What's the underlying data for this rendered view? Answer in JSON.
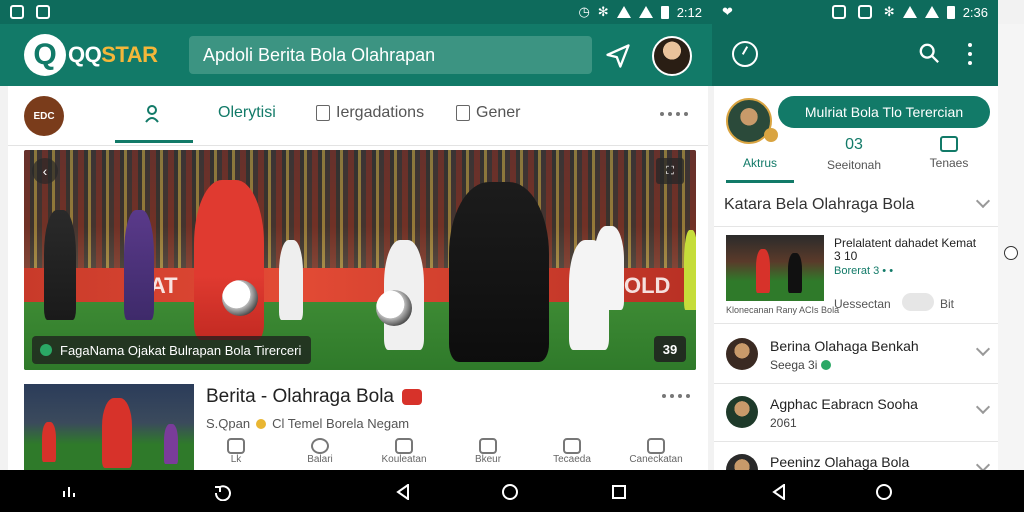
{
  "status_left": {
    "time": "2:12"
  },
  "status_right": {
    "time": "2:36"
  },
  "app": {
    "logo_q": "Q",
    "logo_text_a": "QQ",
    "logo_text_b": "STAR",
    "search_placeholder": "Apdoli Berita Bola Olahrapan"
  },
  "tabs": {
    "channel_logo": "EDC",
    "items": [
      {
        "label": "Olerytisi"
      },
      {
        "label": "Iergadations"
      },
      {
        "label": "Gener"
      }
    ]
  },
  "hero": {
    "ad_1": "DAT",
    "ad_2": "OLD",
    "expand_label": "⛶",
    "caption": "FagaNama Ojakat Bulrapan Bola Tirerceri",
    "count": "39"
  },
  "article": {
    "title": "Berita - Olahraga Bola",
    "meta_source": "S.Qpan",
    "meta_text": "Cl Temel Borela Negam",
    "actions": [
      {
        "label": "Lk"
      },
      {
        "label": "Balari"
      },
      {
        "label": "Kouleatan"
      },
      {
        "label": "Bkeur"
      },
      {
        "label": "Tecaeda"
      },
      {
        "label": "Caneckatan"
      }
    ]
  },
  "right": {
    "cta": "Mulriat Bola Tlo Terercian",
    "tabs": [
      {
        "label": "Aktrus",
        "count": ""
      },
      {
        "label": "Seeitonah",
        "count": "03"
      },
      {
        "label": "Tenaes",
        "count": ""
      }
    ],
    "section_title": "Katara Bela Olahraga Bola",
    "card": {
      "title": "Prelalatent dahadet Kemat 3 10",
      "sub": "Borerat 3 • •",
      "source": "Klonecanan Rany ACIs Bola",
      "foot": "Uessectan",
      "foot2": "Bit"
    },
    "items": [
      {
        "name": "Berina Olahaga Benkah",
        "sub": "Seega 3i"
      },
      {
        "name": "Agphac Eabracn Sooha",
        "sub": "2061"
      },
      {
        "name": "Peeninz Olahaga Bola",
        "sub": ""
      }
    ]
  },
  "colors": {
    "primary": "#127a68",
    "primary_dark": "#0e6b5c",
    "accent": "#f4b73a"
  }
}
